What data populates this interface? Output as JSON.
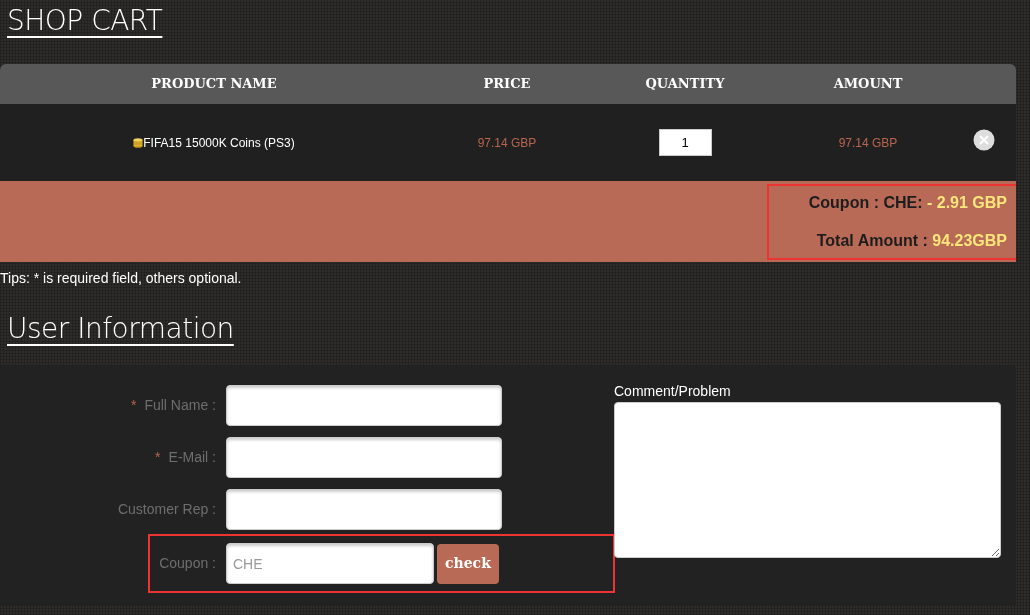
{
  "title": "SHOP CART",
  "cart": {
    "columns": [
      "PRODUCT NAME",
      "PRICE",
      "QUANTITY",
      "AMOUNT"
    ],
    "rows": [
      {
        "product": "FIFA15 15000K Coins (PS3)",
        "price": "97.14 GBP",
        "quantity": "1",
        "amount": "97.14 GBP"
      }
    ],
    "summary": {
      "highlighted": true,
      "lines": [
        {
          "label": "Coupon : CHE:",
          "value": "- 2.91 GBP"
        },
        {
          "label": "Total Amount :",
          "value": "94.23GBP"
        }
      ]
    }
  },
  "tips": "Tips: * is required field, others optional.",
  "user_info": {
    "title": "User Information",
    "fields": [
      {
        "kind": "text",
        "required_mark": "*",
        "label": "Full Name :"
      },
      {
        "kind": "text",
        "required_mark": "*",
        "label": "E-Mail :"
      },
      {
        "kind": "text",
        "label": "Customer Rep :"
      },
      {
        "kind": "coupon",
        "label": "Coupon :",
        "value": "CHE",
        "button": "check",
        "highlighted": true
      }
    ],
    "comment": {
      "label": "Comment/Problem"
    }
  }
}
